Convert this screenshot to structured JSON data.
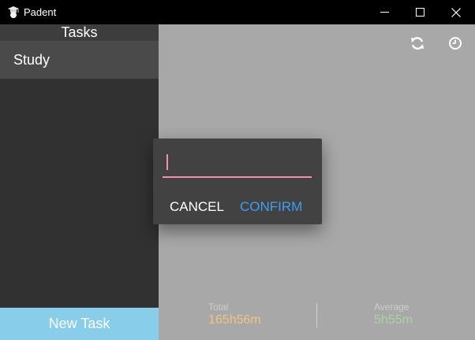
{
  "window": {
    "title": "Padent",
    "icons": {
      "app": "graduation-cap-icon",
      "minimize": "minimize-icon",
      "maximize": "maximize-icon",
      "close": "close-icon"
    }
  },
  "sidebar": {
    "header": "Tasks",
    "tasks": [
      {
        "label": "Study"
      }
    ],
    "new_task_label": "New Task"
  },
  "main": {
    "toolbar_icons": [
      "refresh-icon",
      "clock-icon"
    ],
    "stats": {
      "total": {
        "label": "Total",
        "value": "165h56m"
      },
      "average": {
        "label": "Average",
        "value": "5h55m"
      }
    }
  },
  "dialog": {
    "input_value": "",
    "cancel_label": "CANCEL",
    "confirm_label": "CONFIRM"
  },
  "colors": {
    "sidebar_bg": "#313131",
    "new_task_bg": "#88cdea",
    "main_bg": "#a8a8a8",
    "dialog_bg": "#424242",
    "input_accent": "#f48fb1",
    "confirm": "#3d9ef4",
    "total_value": "#f3c47e",
    "average_value": "#a8d6a0"
  }
}
